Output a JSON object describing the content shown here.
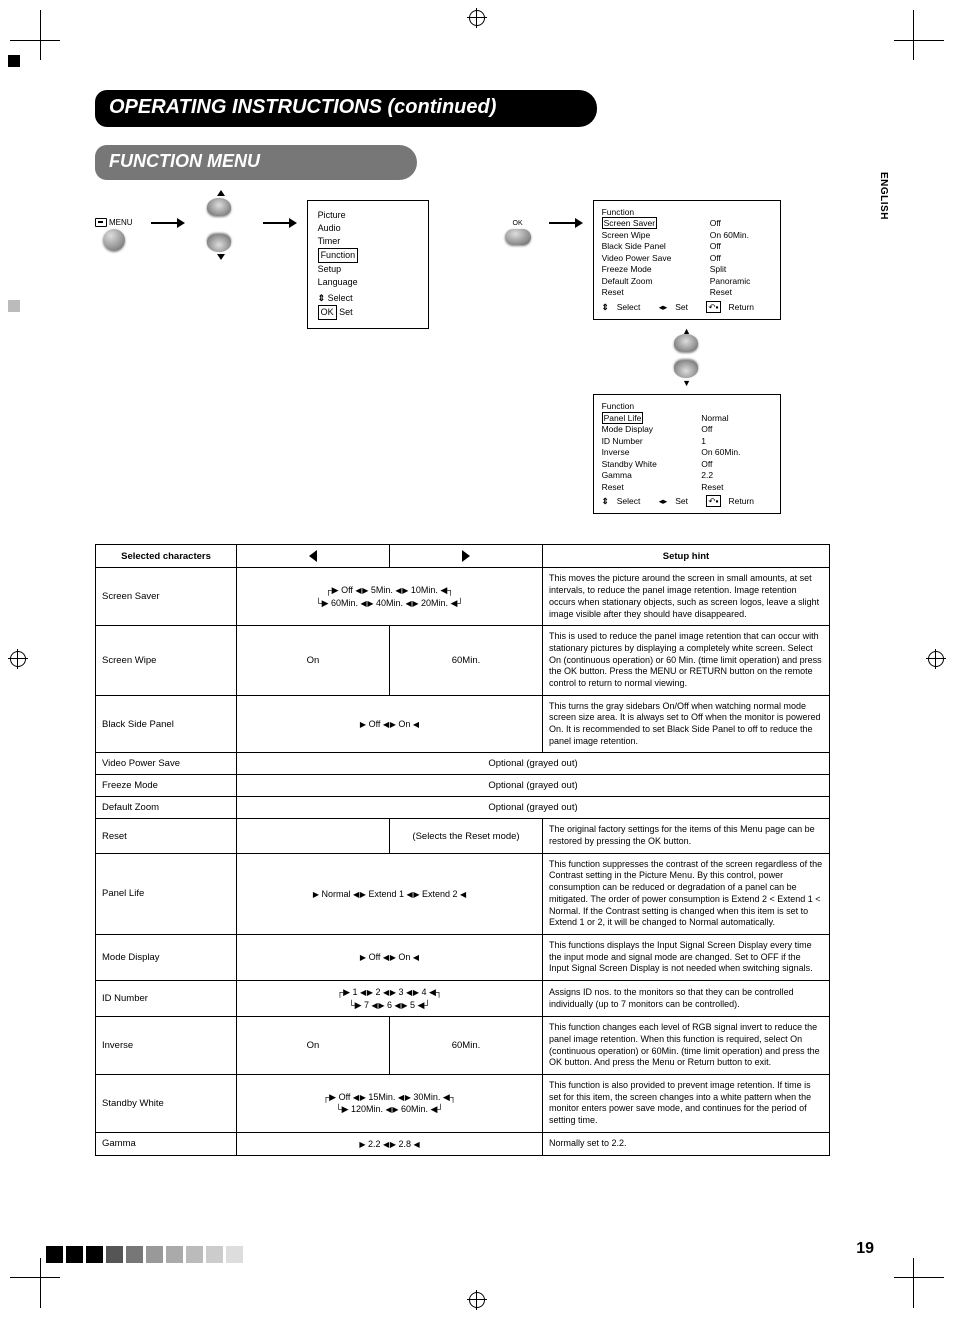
{
  "page_number": "19",
  "language_tab": "ENGLISH",
  "main_title": "OPERATING INSTRUCTIONS (continued)",
  "sub_title": "FUNCTION MENU",
  "remote": {
    "menu_label": "MENU",
    "ok_label": "OK"
  },
  "main_menu": {
    "items": [
      "Picture",
      "Audio",
      "Timer",
      "Function",
      "Setup",
      "Language"
    ],
    "highlighted": "Function",
    "footer_select": "Select",
    "footer_set": "Set",
    "footer_set_key": "OK"
  },
  "function_menu_1": {
    "title": "Function",
    "rows": [
      {
        "label": "Screen Saver",
        "value": "Off",
        "highlight": true
      },
      {
        "label": "Screen Wipe",
        "value": "On  60Min."
      },
      {
        "label": "Black Side Panel",
        "value": "Off"
      },
      {
        "label": "Video Power Save",
        "value": "Off"
      },
      {
        "label": "Freeze Mode",
        "value": "Split"
      },
      {
        "label": "Default Zoom",
        "value": "Panoramic"
      },
      {
        "label": "Reset",
        "value": "Reset"
      }
    ],
    "footer": {
      "select_key": "▲▼",
      "select": "Select",
      "set_key": "◀▶",
      "set": "Set",
      "return": "Return"
    }
  },
  "function_menu_2": {
    "title": "Function",
    "rows": [
      {
        "label": "Panel Life",
        "value": "Normal",
        "highlight": true
      },
      {
        "label": "Mode Display",
        "value": "Off"
      },
      {
        "label": "ID Number",
        "value": "1"
      },
      {
        "label": "Inverse",
        "value": "On  60Min."
      },
      {
        "label": "Standby White",
        "value": "Off"
      },
      {
        "label": "Gamma",
        "value": "2.2"
      },
      {
        "label": "Reset",
        "value": "Reset"
      }
    ],
    "footer": {
      "select_key": "▲▼",
      "select": "Select",
      "set_key": "◀▶",
      "set": "Set",
      "return": "Return"
    }
  },
  "chart_data": {
    "type": "table",
    "headers": [
      "Selected characters",
      "◀",
      "▶",
      "Setup hint"
    ],
    "rows": [
      {
        "name": "Screen Saver",
        "cycle": "Off ↔ 5Min. ↔ 10Min. ↔ 20Min. ↔ 40Min. ↔ 60Min. (loop)",
        "left": "",
        "right": "",
        "hint": "This moves the picture around the screen in small amounts, at set intervals, to reduce the panel image retention. Image retention occurs when stationary objects, such as screen logos, leave a slight image visible after they should have disappeared."
      },
      {
        "name": "Screen Wipe",
        "left": "On",
        "right": "60Min.",
        "hint": "This is used to reduce the panel image retention that can occur with stationary pictures by displaying a completely white screen. Select On (continuous operation) or 60 Min. (time limit operation) and press the OK button. Press the MENU or RETURN button on the remote control to return to normal viewing."
      },
      {
        "name": "Black Side Panel",
        "cycle": "Off ↔ On (loop)",
        "hint": "This turns the gray sidebars On/Off when watching normal mode screen size area. It is always set to Off when the monitor is powered On. It is recommended to set Black Side Panel to off to reduce the panel image retention."
      },
      {
        "name": "Video Power Save",
        "span_all": "Optional (grayed out)"
      },
      {
        "name": "Freeze Mode",
        "span_all": "Optional (grayed out)"
      },
      {
        "name": "Default Zoom",
        "span_all": "Optional (grayed out)"
      },
      {
        "name": "Reset",
        "right": "(Selects the Reset mode)",
        "hint": "The original factory settings for the items of this Menu page can be restored by pressing the OK button."
      },
      {
        "name": "Panel Life",
        "cycle": "Normal ↔ Extend 1 ↔ Extend 2 (loop)",
        "hint": "This function suppresses the contrast of the screen regardless of the Contrast setting in the Picture Menu. By this control, power consumption can be reduced or degradation of a panel can be mitigated. The order of power consumption is Extend 2 < Extend 1 < Normal.\nIf the Contrast setting is changed when this item is set to Extend 1 or 2, it will be changed to Normal automatically."
      },
      {
        "name": "Mode Display",
        "cycle": "Off ↔ On (loop)",
        "hint": "This functions displays the Input Signal Screen Display every time the input mode and signal mode are changed.\nSet to OFF if the Input Signal Screen Display is not needed when switching signals."
      },
      {
        "name": "ID Number",
        "cycle": "1 ↔ 2 ↔ 3 ↔ 4 ↔ 5 ↔ 6 ↔ 7 (loop)",
        "hint": "Assigns ID nos. to the monitors so that they can be controlled individually (up to 7 monitors can be controlled)."
      },
      {
        "name": "Inverse",
        "left": "On",
        "right": "60Min.",
        "hint": "This function changes each level of RGB signal invert to reduce the panel image retention. When this function is required, select On (continuous operation) or 60Min. (time limit operation) and press the OK button. And press the Menu or Return button to exit."
      },
      {
        "name": "Standby White",
        "cycle": "Off ↔ 15Min. ↔ 30Min. ↔ 60Min. ↔ 120Min. (loop)",
        "hint": "This function is also provided to prevent image retention. If time is set for this item, the screen changes into a white pattern when the monitor enters power save mode, and continues for the period of setting time."
      },
      {
        "name": "Gamma",
        "cycle": "2.2 ↔ 2.8 (loop)",
        "hint": "Normally set to 2.2."
      }
    ]
  }
}
